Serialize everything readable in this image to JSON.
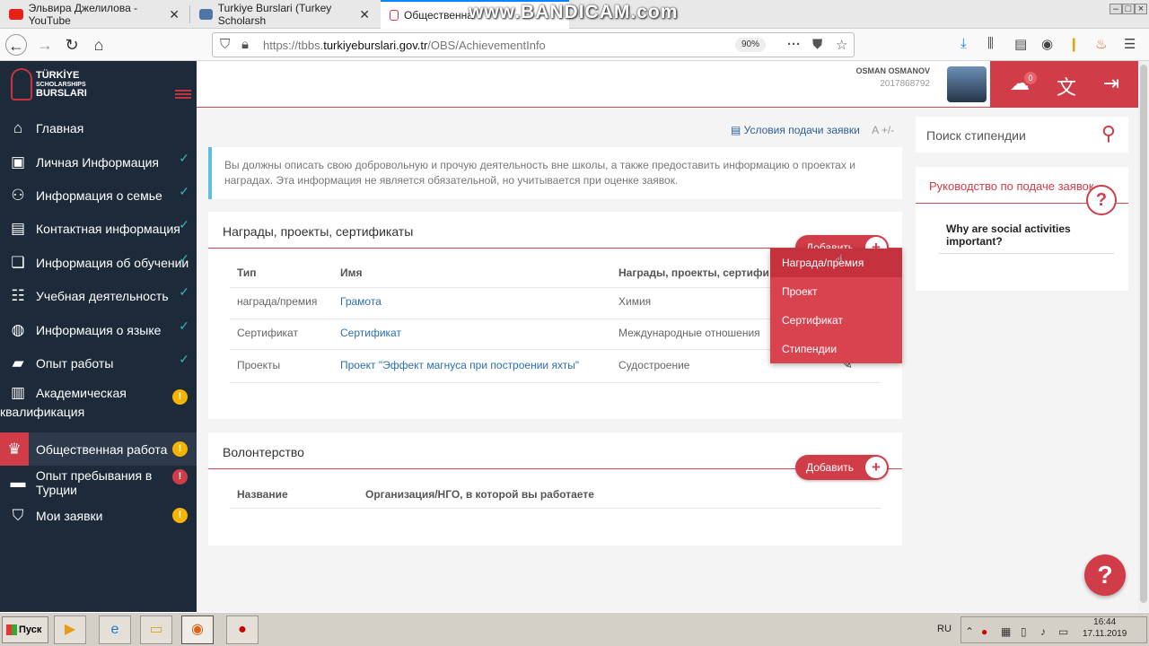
{
  "browser": {
    "tabs": [
      {
        "title": "Эльвира Джелилова - YouTube",
        "icon_color": "#e62117"
      },
      {
        "title": "Turkiye Burslari (Turkey Scholarsh",
        "icon_color": "#4a76a8"
      },
      {
        "title": "Общественна",
        "icon_color": "#d03c48"
      }
    ],
    "watermark": "www.BANDICAM.com",
    "url_prefix": "https://tbbs.",
    "url_domain": "turkiyeburslari.gov.tr",
    "url_path": "/OBS/AchievementInfo",
    "zoom": "90%"
  },
  "sidebar": {
    "logo_line1": "TÜRKİYE",
    "logo_line2": "SCHOLARSHIPS",
    "logo_line3": "BURSLARI",
    "items": [
      {
        "label": "Главная",
        "icon": "home-icon",
        "status": "none"
      },
      {
        "label": "Личная Информация",
        "icon": "id-card-icon",
        "status": "done"
      },
      {
        "label": "Информация о семье",
        "icon": "people-icon",
        "status": "done"
      },
      {
        "label": "Контактная информация",
        "icon": "contact-card-icon",
        "status": "done"
      },
      {
        "label": "Информация об обучении",
        "icon": "book-icon",
        "status": "done"
      },
      {
        "label": "Учебная деятельность",
        "icon": "list-icon",
        "status": "done"
      },
      {
        "label": "Информация о языке",
        "icon": "globe-icon",
        "status": "done"
      },
      {
        "label": "Опыт работы",
        "icon": "briefcase-icon",
        "status": "done"
      },
      {
        "label_line1": "Академическая",
        "label_line2": "квалификация",
        "icon": "certificate-icon",
        "status": "warning"
      },
      {
        "label": "Общественная работа",
        "icon": "medal-icon",
        "status": "warning"
      },
      {
        "label": "Опыт пребывания в Турции",
        "icon": "chat-icon",
        "status": "error"
      },
      {
        "label": "Мои заявки",
        "icon": "shield-check-icon",
        "status": "warning"
      }
    ]
  },
  "header": {
    "user_name": "OSMAN OSMANOV",
    "user_id": "2017868792",
    "notifications": "0"
  },
  "main": {
    "conditions_link": "Условия подачи заявки",
    "font_size_ctrl": "A +/-",
    "info_text": "Вы должны описать свою добровольную и прочую деятельность вне школы, а также предоставить информацию о проектах и наградах. Эта информация не является обязательной, но учитывается при оценке заявок.",
    "awards": {
      "title": "Награды, проекты, сертификаты",
      "add_label": "Добавить",
      "columns": [
        "Тип",
        "Имя",
        "Награды, проекты, сертифи"
      ],
      "rows": [
        {
          "type": "награда/премия",
          "name": "Грамота",
          "field": "Химия"
        },
        {
          "type": "Сертификат",
          "name": "Сертификат",
          "field": "Международные отношения"
        },
        {
          "type": "Проекты",
          "name": "Проект \"Эффект магнуса при построении яхты\"",
          "field": "Судостроение"
        }
      ],
      "dropdown": [
        "Награда/премия",
        "Проект",
        "Сертификат",
        "Стипендии"
      ]
    },
    "volunteer": {
      "title": "Волонтерство",
      "add_label": "Добавить",
      "columns": [
        "Название",
        "Организация/НГО, в которой вы работаете"
      ]
    }
  },
  "right": {
    "search_label": "Поиск стипендии",
    "guide_title": "Руководство по подаче заявок",
    "guide_item": "Why are social activities important?"
  },
  "taskbar": {
    "start": "Пуск",
    "lang": "RU",
    "time": "16:44",
    "date": "17.11.2019"
  }
}
